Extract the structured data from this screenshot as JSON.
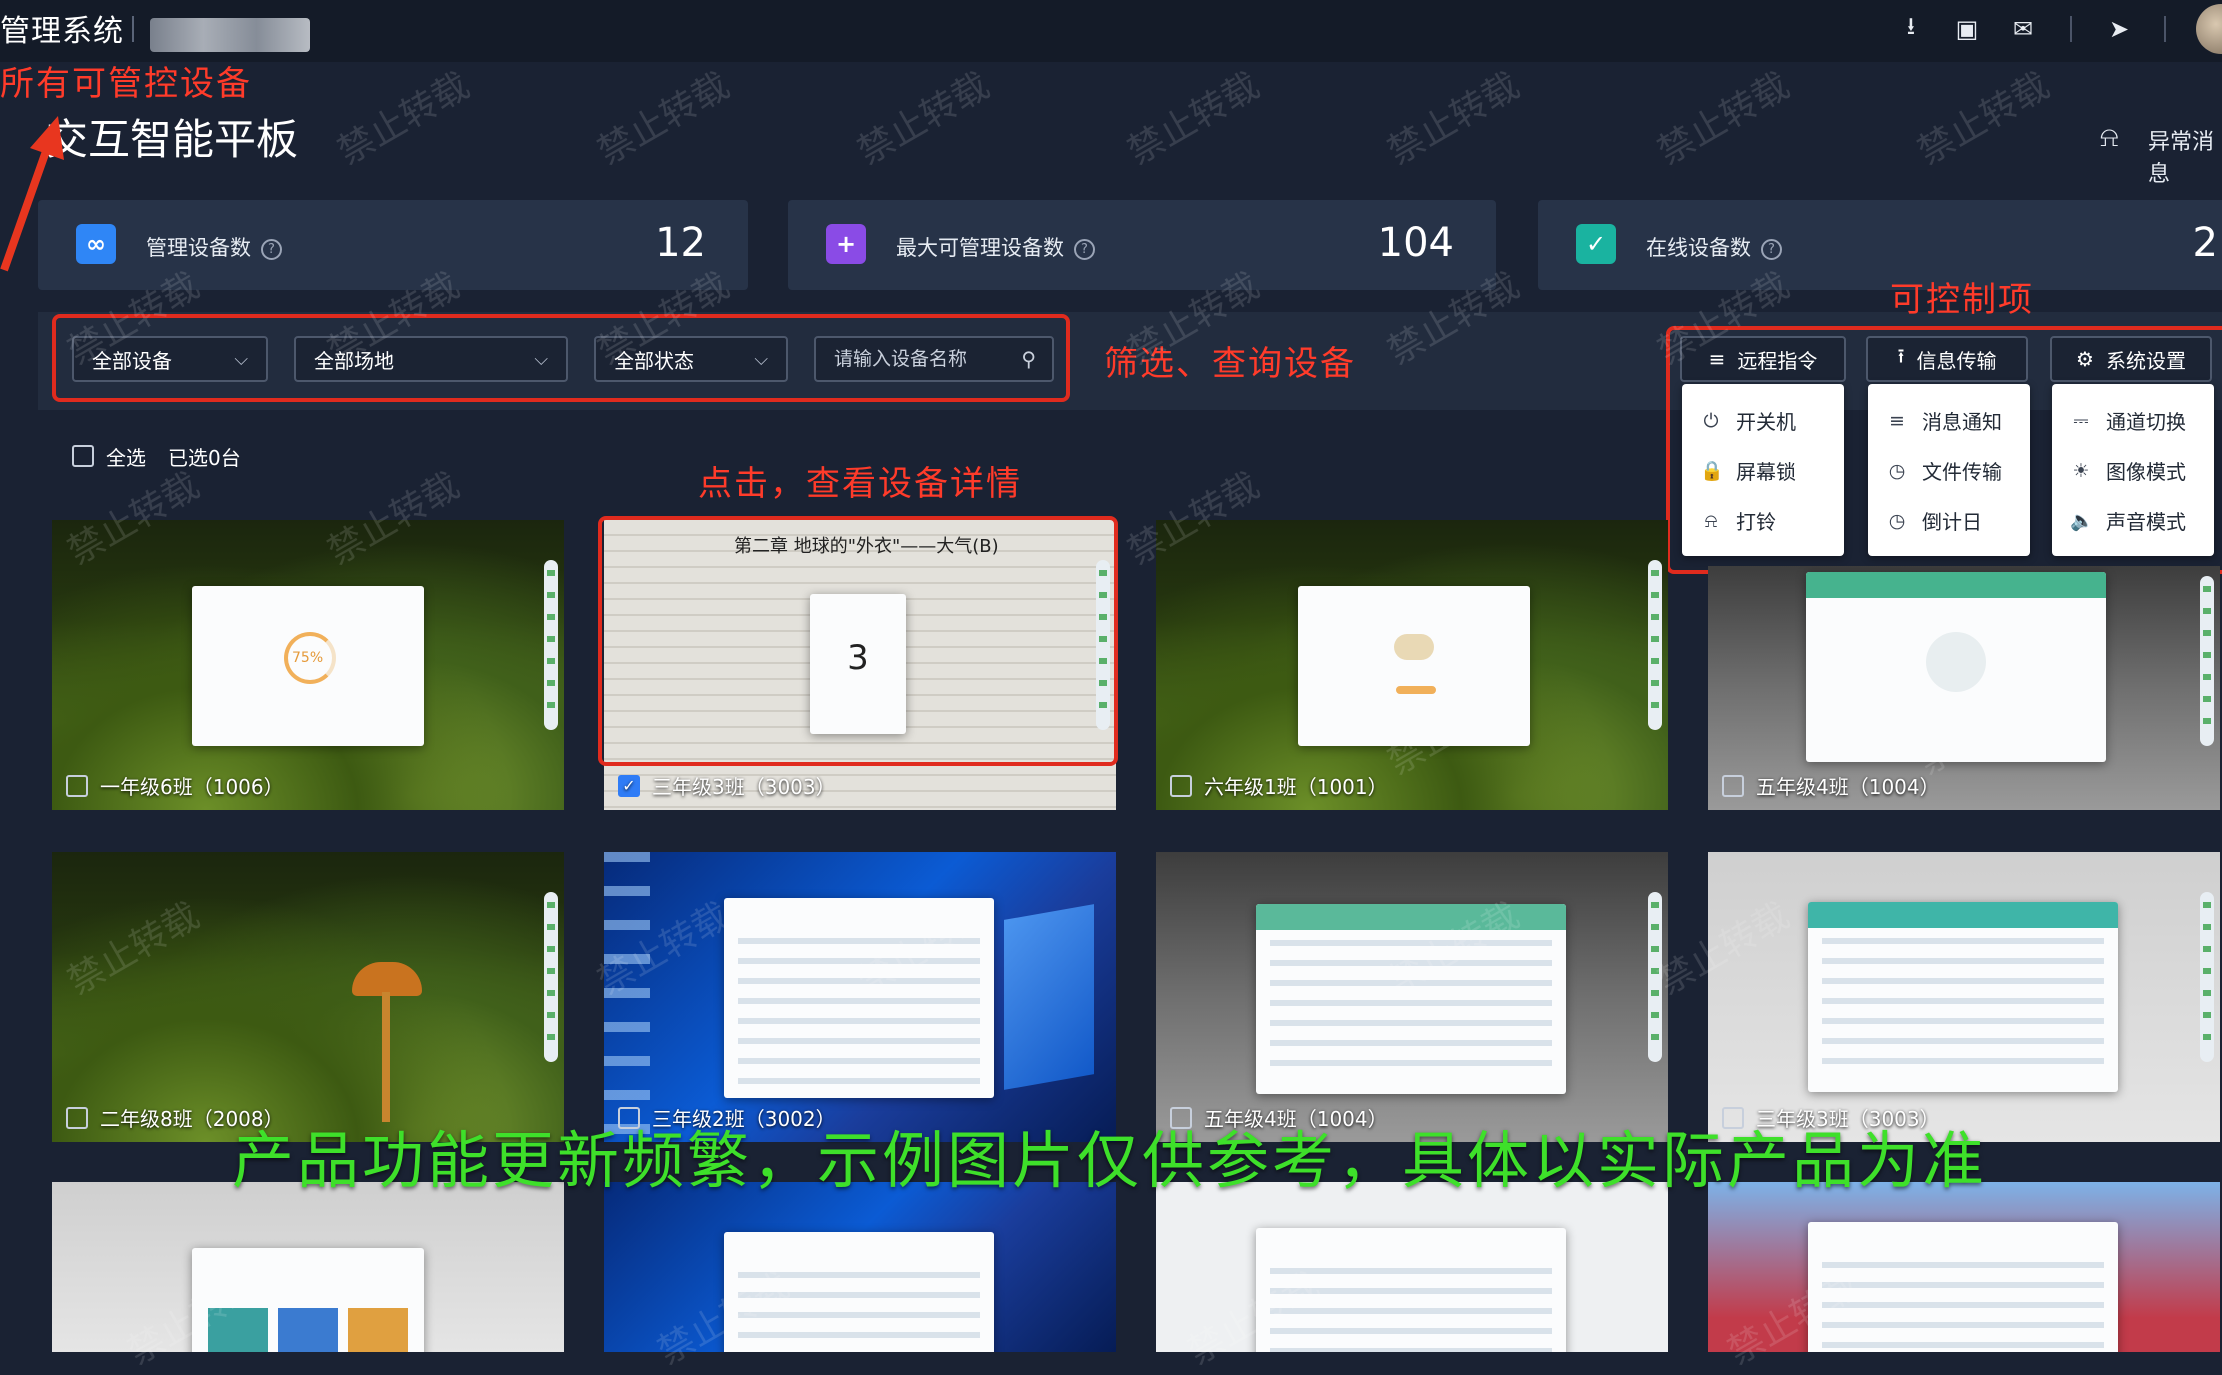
{
  "header": {
    "system_title": "管理系统",
    "page_title": "交互智能平板",
    "alert_link": "异常消息",
    "icons": [
      "download-icon",
      "book-icon",
      "message-icon",
      "send-icon"
    ]
  },
  "stats": [
    {
      "label": "管理设备数",
      "value": "12",
      "icon": "link-icon",
      "color": "#2f86f6"
    },
    {
      "label": "最大可管理设备数",
      "value": "104",
      "icon": "plus-icon",
      "color": "#8a4be6"
    },
    {
      "label": "在线设备数",
      "value": "2",
      "icon": "check-icon",
      "color": "#1ab3a0"
    }
  ],
  "filters": {
    "device": "全部设备",
    "venue": "全部场地",
    "status": "全部状态",
    "search_placeholder": "请输入设备名称"
  },
  "controls": {
    "remote": {
      "label": "远程指令",
      "items": [
        "开关机",
        "屏幕锁",
        "打铃"
      ]
    },
    "info": {
      "label": "信息传输",
      "items": [
        "消息通知",
        "文件传输",
        "倒计日"
      ]
    },
    "system": {
      "label": "系统设置",
      "items": [
        "通道切换",
        "图像模式",
        "声音模式"
      ]
    }
  },
  "selection": {
    "select_all": "全选",
    "selected_count": "已选0台"
  },
  "devices": [
    {
      "name": "一年级6班（1006）",
      "checked": false
    },
    {
      "name": "三年级3班（3003）",
      "checked": true
    },
    {
      "name": "六年级1班（1001）",
      "checked": false
    },
    {
      "name": "五年级4班（1004）",
      "checked": false
    },
    {
      "name": "二年级8班（2008）",
      "checked": false
    },
    {
      "name": "三年级2班（3002）",
      "checked": false
    },
    {
      "name": "五年级4班（1004）",
      "checked": false
    },
    {
      "name": "三年级3班（3003）",
      "checked": false
    }
  ],
  "preview": {
    "progress": "75%",
    "doc_title": "第二章  地球的\"外衣\"——大气(B)",
    "countdown": "3"
  },
  "annotations": {
    "all_devices": "所有可管控设备",
    "filter": "筛选、查询设备",
    "controls": "可控制项",
    "click_detail": "点击，查看设备详情",
    "note": "产品功能更新频繁，示例图片仅供参考，具体以实际产品为准"
  },
  "watermark": "禁止转载"
}
